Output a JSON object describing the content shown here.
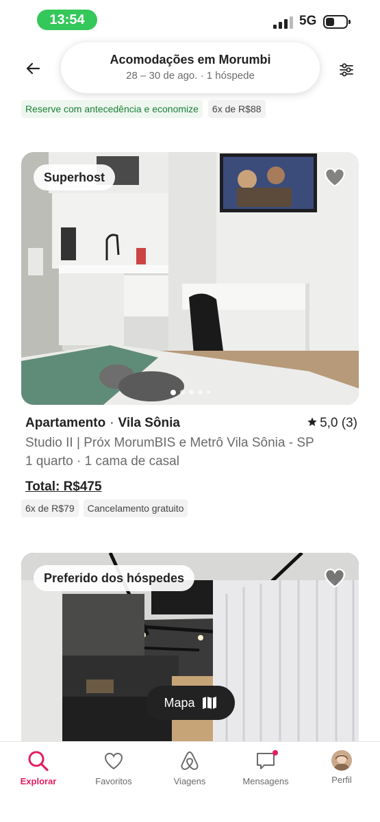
{
  "status_bar": {
    "time": "13:54",
    "network": "5G",
    "battery_percent": 35
  },
  "header": {
    "title": "Acomodações em Morumbi",
    "subtitle": "28 – 30 de ago. · 1 hóspede"
  },
  "previous_listing": {
    "chips": [
      "Reserve com antecedência e economize",
      "6x de R$88"
    ]
  },
  "listing1": {
    "badge": "Superhost",
    "type": "Apartamento",
    "separator": "·",
    "neighborhood": "Vila Sônia",
    "rating": "5,0 (3)",
    "title": "Studio II | Próx MorumBIS e Metrô Vila Sônia - SP",
    "beds": "1 quarto · 1 cama de casal",
    "total": "Total: R$475",
    "chips": [
      "6x de R$79",
      "Cancelamento gratuito"
    ],
    "photo_index": 1,
    "photo_count": 5
  },
  "listing2": {
    "badge": "Preferido dos hóspedes"
  },
  "map_button": {
    "label": "Mapa"
  },
  "bottom_nav": {
    "items": [
      {
        "label": "Explorar",
        "icon": "search-icon",
        "active": true
      },
      {
        "label": "Favoritos",
        "icon": "heart-icon",
        "active": false
      },
      {
        "label": "Viagens",
        "icon": "airbnb-logo-icon",
        "active": false
      },
      {
        "label": "Mensagens",
        "icon": "message-icon",
        "active": false
      },
      {
        "label": "Perfil",
        "icon": "avatar",
        "active": false
      }
    ]
  },
  "colors": {
    "brand": "#e31c5f",
    "status_green": "#34c759",
    "text": "#222222",
    "muted": "#6a6a6a"
  }
}
